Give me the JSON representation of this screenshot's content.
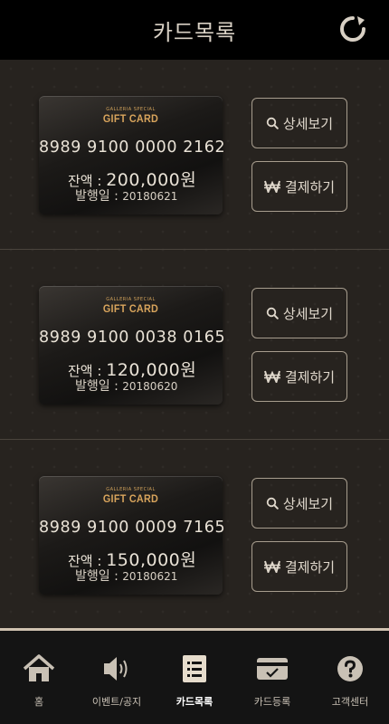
{
  "header": {
    "title": "카드목록",
    "refresh_icon": "refresh-icon"
  },
  "cards": [
    {
      "brand_small": "GALLERIA SPECIAL",
      "brand_large": "GIFT CARD",
      "number": "8989 9100 0000 2162",
      "balance_label": "잔액 : ",
      "balance": "200,000원",
      "issued_label": "발행일 : ",
      "issued": "20180621",
      "detail_label": "상세보기",
      "pay_label": "결제하기"
    },
    {
      "brand_small": "GALLERIA SPECIAL",
      "brand_large": "GIFT CARD",
      "number": "8989 9100 0038 0165",
      "balance_label": "잔액 : ",
      "balance": "120,000원",
      "issued_label": "발행일 : ",
      "issued": "20180620",
      "detail_label": "상세보기",
      "pay_label": "결제하기"
    },
    {
      "brand_small": "GALLERIA SPECIAL",
      "brand_large": "GIFT CARD",
      "number": "8989 9100 0009 7165",
      "balance_label": "잔액 : ",
      "balance": "150,000원",
      "issued_label": "발행일 : ",
      "issued": "20180621",
      "detail_label": "상세보기",
      "pay_label": "결제하기"
    }
  ],
  "tabs": [
    {
      "label": "홈",
      "icon": "home-icon"
    },
    {
      "label": "이벤트/공지",
      "icon": "speaker-icon"
    },
    {
      "label": "카드목록",
      "icon": "list-icon",
      "active": true
    },
    {
      "label": "카드등록",
      "icon": "card-register-icon"
    },
    {
      "label": "고객센터",
      "icon": "help-icon"
    }
  ],
  "colors": {
    "accent_gold": "#d8a45c",
    "background": "#27231f",
    "button_border": "#a79d8e"
  }
}
